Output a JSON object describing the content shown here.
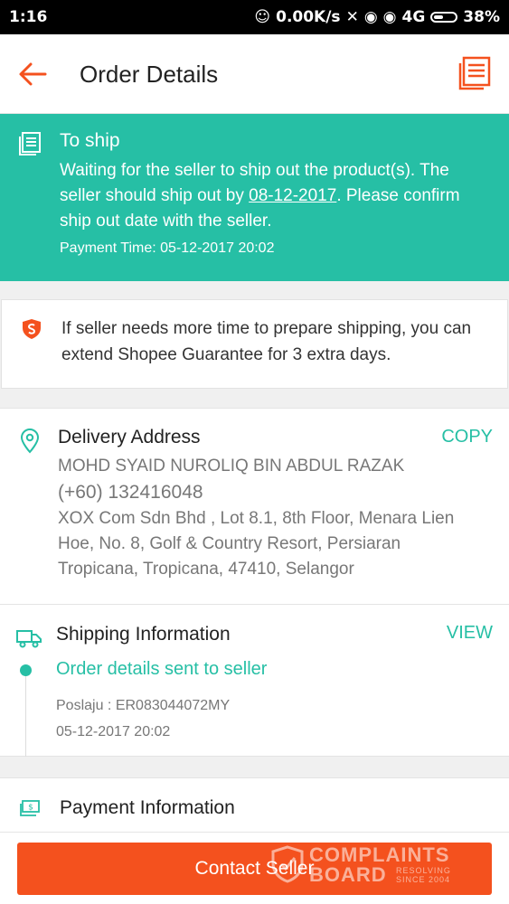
{
  "status_bar": {
    "time": "1:16",
    "net_speed": "0.00K/s",
    "network": "4G",
    "battery": "38%"
  },
  "header": {
    "title": "Order Details",
    "back_icon": "arrow-left-icon",
    "menu_icon": "document-list-icon",
    "accent_color": "#f4511e"
  },
  "status_banner": {
    "status": "To ship",
    "message_before": "Waiting for the seller to ship out the product(s). The seller should ship out by ",
    "ship_by_date": "08-12-2017",
    "message_after": ". Please confirm ship out date with the seller.",
    "payment_time": "Payment Time: 05-12-2017 20:02",
    "color": "#26bfa5"
  },
  "guarantee": {
    "text": "If seller needs more time to prepare shipping, you can extend Shopee Guarantee for 3 extra days."
  },
  "delivery_address": {
    "heading": "Delivery Address",
    "copy_label": "COPY",
    "name": "MOHD SYAID NUROLIQ BIN ABDUL RAZAK",
    "phone": "(+60) 132416048",
    "address": "XOX Com Sdn Bhd , Lot 8.1, 8th Floor, Menara Lien Hoe, No. 8, Golf & Country Resort, Persiaran Tropicana, Tropicana, 47410, Selangor"
  },
  "shipping_information": {
    "heading": "Shipping Information",
    "view_label": "VIEW",
    "latest_event": "Order details sent to seller",
    "tracking": "Poslaju :  ER083044072MY",
    "event_time": "05-12-2017 20:02"
  },
  "payment_information": {
    "heading": "Payment Information"
  },
  "footer": {
    "contact_button": "Contact Seller",
    "button_color": "#f4511e"
  },
  "watermark": {
    "line1": "COMPLAINTS",
    "line2": "BOARD",
    "tag1": "RESOLVING",
    "tag2": "SINCE 2004"
  }
}
